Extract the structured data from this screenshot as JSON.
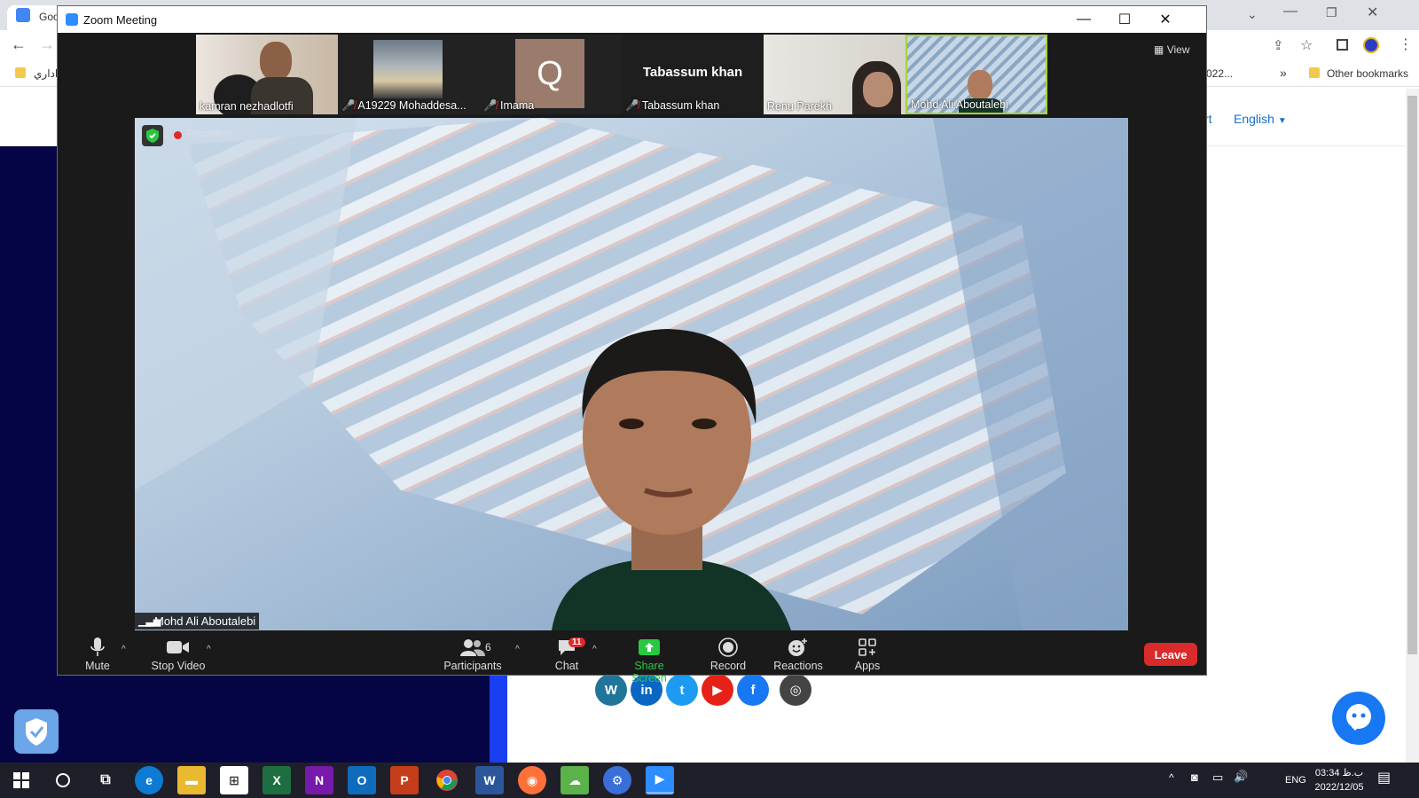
{
  "browser": {
    "tab_title": "Goo",
    "bookmark_rtl": "اداري",
    "bookmark_partial": "022...",
    "more_bookmarks": "»",
    "other_bookmarks": "Other bookmarks",
    "page_link_partial": "rt",
    "language_link": "English"
  },
  "zoom": {
    "window_title": "Zoom Meeting",
    "view_label": "View",
    "recording_label": "Recording",
    "active_speaker": "Mohd Ali Aboutalebi",
    "participants_strip": [
      {
        "name": "kamran nezhadlotfi",
        "muted": false
      },
      {
        "name": "A19229  Mohaddesa...",
        "muted": true
      },
      {
        "name": "Imama",
        "muted": true,
        "avatar_letter": "Q"
      },
      {
        "name": "Tabassum khan",
        "muted": true,
        "display_text": "Tabassum khan"
      },
      {
        "name": "Renu Parekh",
        "muted": false
      },
      {
        "name": "Mohd Ali Aboutalebi",
        "muted": false,
        "active": true
      }
    ],
    "toolbar": {
      "mute": "Mute",
      "stop_video": "Stop Video",
      "participants": "Participants",
      "participants_count": "6",
      "chat": "Chat",
      "chat_badge": "11",
      "share_screen": "Share Screen",
      "record": "Record",
      "reactions": "Reactions",
      "apps": "Apps",
      "leave": "Leave"
    },
    "colors": {
      "share_green": "#27c93f",
      "leave_red": "#d92b2b",
      "active_border": "#a8d33a"
    }
  },
  "taskbar": {
    "time": "03:34 ب.ظ",
    "date": "2022/12/05",
    "language": "ENG"
  }
}
